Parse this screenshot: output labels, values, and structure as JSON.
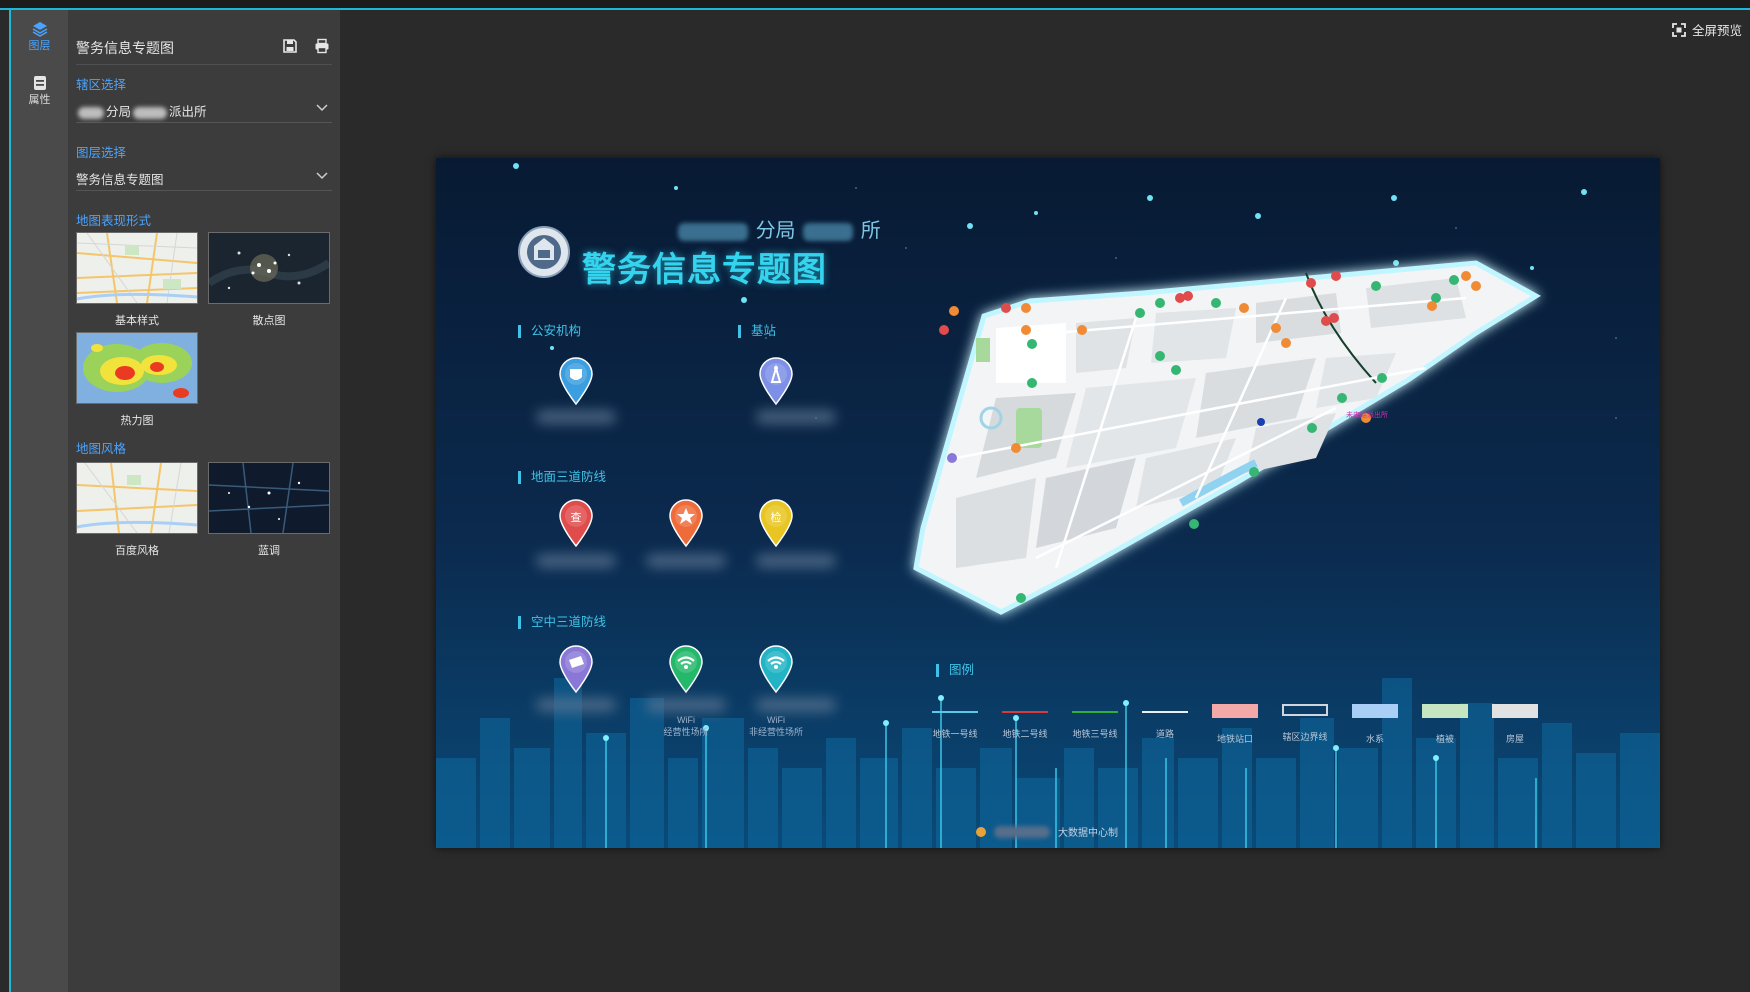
{
  "rail": {
    "tabs": [
      {
        "label": "图层",
        "icon": "layers-icon",
        "active": true
      },
      {
        "label": "属性",
        "icon": "properties-icon",
        "active": false
      }
    ]
  },
  "panel": {
    "title": "警务信息专题图",
    "save_icon": "save-icon",
    "print_icon": "print-icon",
    "district_label": "辖区选择",
    "district_value_mid": "分局",
    "district_value_end": "派出所",
    "layer_label": "图层选择",
    "layer_value": "警务信息专题图",
    "map_form_label": "地图表现形式",
    "map_forms": [
      "基本样式",
      "散点图",
      "热力图"
    ],
    "map_style_label": "地图风格",
    "map_styles": [
      "百度风格",
      "蓝调"
    ]
  },
  "toolbar": {
    "fullscreen_label": "全屏预览",
    "fullscreen_icon": "fullscreen-icon"
  },
  "poster": {
    "subtitle_a": "分局",
    "subtitle_b": "所",
    "title": "警务信息专题图",
    "categories": {
      "police": "公安机构",
      "station": "基站",
      "ground": "地面三道防线",
      "air": "空中三道防线"
    },
    "pins": [
      {
        "id": "police",
        "color": "#3a9ee0",
        "glyph": "shield",
        "caption": ""
      },
      {
        "id": "station",
        "color": "#7d8fe6",
        "glyph": "tower",
        "caption": ""
      },
      {
        "id": "check",
        "color": "#e04b4b",
        "glyph": "查",
        "caption": ""
      },
      {
        "id": "service",
        "color": "#ef6b3a",
        "glyph": "star",
        "caption": ""
      },
      {
        "id": "inspect",
        "color": "#e8c520",
        "glyph": "检",
        "caption": ""
      },
      {
        "id": "camera",
        "color": "#8a78d8",
        "glyph": "camera",
        "caption": ""
      },
      {
        "id": "wifi1",
        "color": "#23b86a",
        "glyph": "wifi",
        "caption": "WiFi\n经营性场所"
      },
      {
        "id": "wifi2",
        "color": "#22b4c4",
        "glyph": "wifi",
        "caption": "WiFi\n非经营性场所"
      }
    ],
    "map_marker_label": "未来路派出所",
    "legend_title": "图例",
    "legend": [
      {
        "label": "地铁一号线",
        "kind": "line",
        "color": "#5ac8e8"
      },
      {
        "label": "地铁二号线",
        "kind": "line",
        "color": "#d63a3a"
      },
      {
        "label": "地铁三号线",
        "kind": "line",
        "color": "#2fae3a"
      },
      {
        "label": "道路",
        "kind": "line",
        "color": "#e8eef4"
      },
      {
        "label": "地铁站口",
        "kind": "box",
        "color": "#f4a9a9"
      },
      {
        "label": "辖区边界线",
        "kind": "outline",
        "color": "#cfd6de"
      },
      {
        "label": "水系",
        "kind": "box",
        "color": "#a9cff6"
      },
      {
        "label": "植被",
        "kind": "box",
        "color": "#c5e6c0"
      },
      {
        "label": "房屋",
        "kind": "box",
        "color": "#e2e2e2"
      }
    ],
    "footer": "大数据中心制"
  }
}
